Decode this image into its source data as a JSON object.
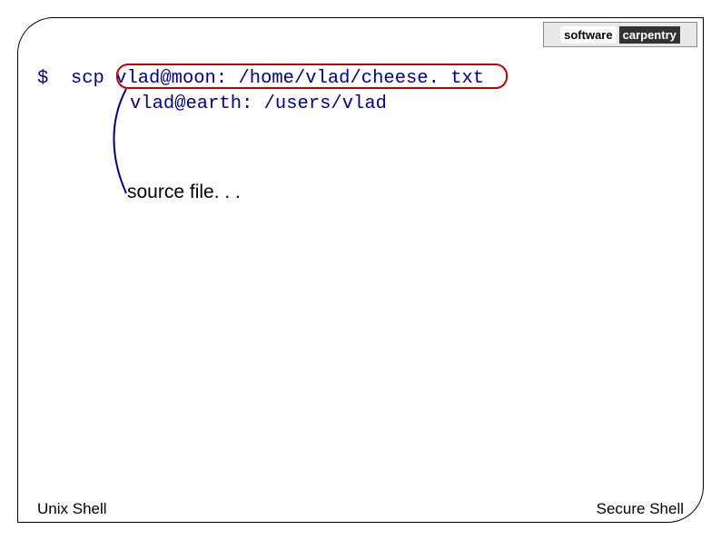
{
  "logo": {
    "software": "software",
    "carpentry": "carpentry"
  },
  "command": {
    "prompt": "$",
    "cmd": "scp",
    "source": "vlad@moon: /home/vlad/cheese. txt",
    "dest": "vlad@earth: /users/vlad"
  },
  "annotation": {
    "label": "source file. . ."
  },
  "footer": {
    "left": "Unix Shell",
    "right": "Secure Shell"
  }
}
